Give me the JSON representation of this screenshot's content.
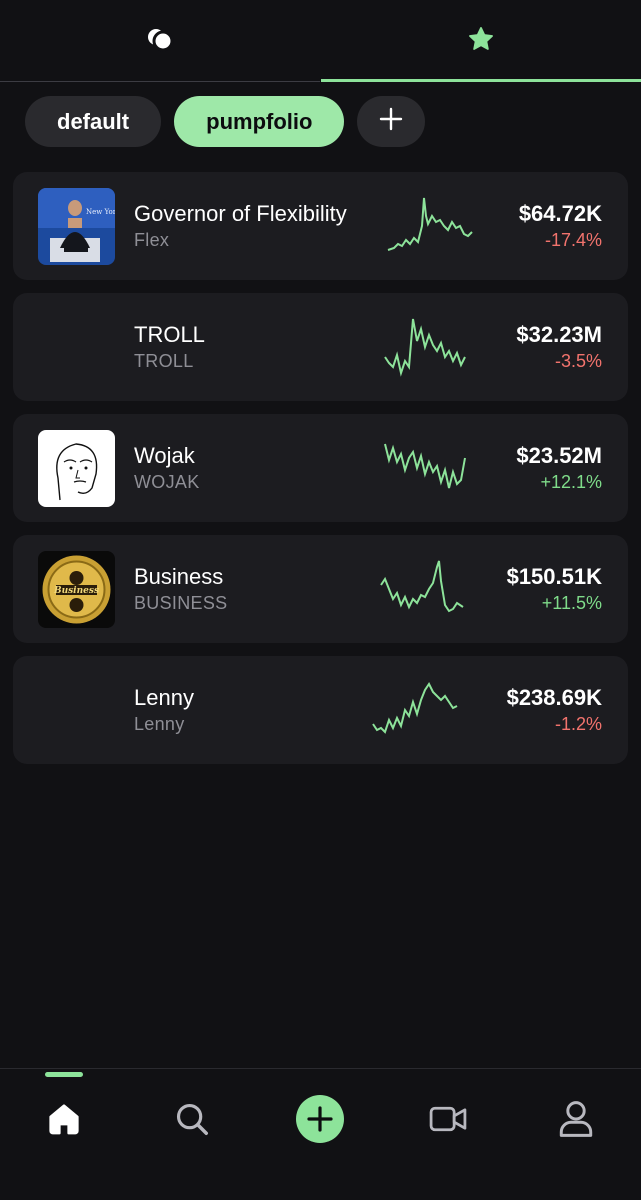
{
  "top_tabs": [
    {
      "icon": "portfolio-coins-icon",
      "selected": false
    },
    {
      "icon": "star-icon",
      "selected": true
    }
  ],
  "portfolio_chips": [
    {
      "label": "default",
      "selected": false
    },
    {
      "label": "pumpfolio",
      "selected": true
    },
    {
      "label": "+",
      "icon": "plus-icon"
    }
  ],
  "tokens": [
    {
      "name": "Governor of Flexibility",
      "ticker": "Flex",
      "price": "$64.72K",
      "change": "-17.4%",
      "direction": "down",
      "avatar": "photo-of-person-seated-on-stage"
    },
    {
      "name": "TROLL",
      "ticker": "TROLL",
      "price": "$32.23M",
      "change": "-3.5%",
      "direction": "down",
      "avatar": "none"
    },
    {
      "name": "Wojak",
      "ticker": "WOJAK",
      "price": "$23.52M",
      "change": "+12.1%",
      "direction": "up",
      "avatar": "wojak-face-drawing"
    },
    {
      "name": "Business",
      "ticker": "BUSINESS",
      "price": "$150.51K",
      "change": "+11.5%",
      "direction": "up",
      "avatar": "gold-business-coin"
    },
    {
      "name": "Lenny",
      "ticker": "Lenny",
      "price": "$238.69K",
      "change": "-1.2%",
      "direction": "down",
      "avatar": "none"
    }
  ],
  "bottom_nav": [
    {
      "icon": "home-icon",
      "selected": true
    },
    {
      "icon": "search-icon",
      "selected": false
    },
    {
      "icon": "create-plus-icon",
      "selected": false
    },
    {
      "icon": "video-camera-icon",
      "selected": false
    },
    {
      "icon": "profile-icon",
      "selected": false
    }
  ],
  "colors": {
    "accent": "#8de39a",
    "negative": "#f2736d",
    "positive": "#7fdc8a",
    "card": "#1c1c20",
    "background": "#111114"
  }
}
